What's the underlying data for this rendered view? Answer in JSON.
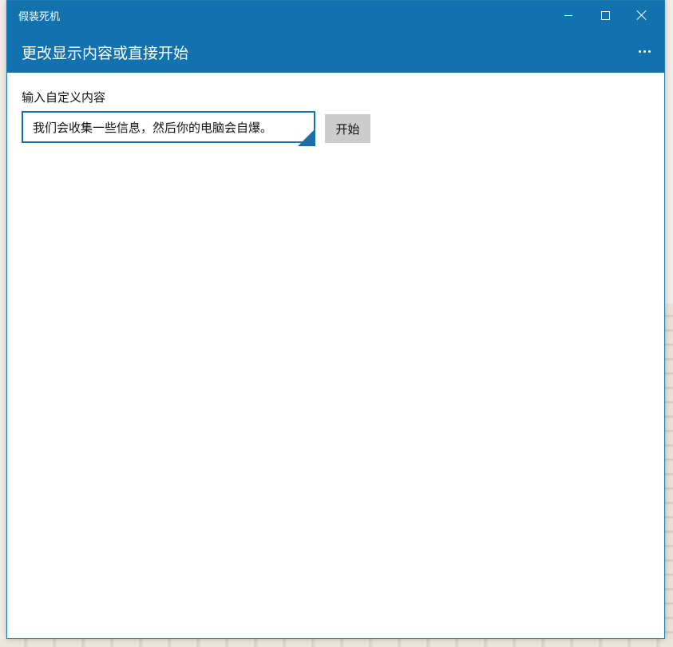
{
  "window": {
    "title": "假装死机"
  },
  "header": {
    "title": "更改显示内容或直接开始",
    "more_icon": "ellipsis-icon"
  },
  "form": {
    "label": "输入自定义内容",
    "input_value": "我们会收集一些信息，然后你的电脑会自爆。",
    "start_label": "开始"
  },
  "colors": {
    "accent": "#1172ad",
    "button_bg": "#cccccc"
  }
}
